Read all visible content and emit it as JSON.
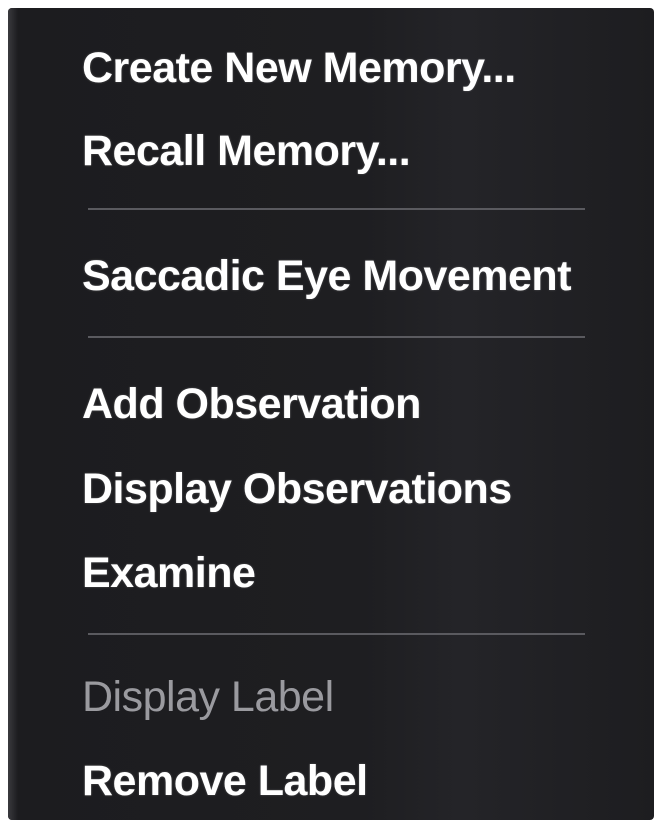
{
  "menu": {
    "items": [
      {
        "label": "Create New Memory...",
        "enabled": true
      },
      {
        "label": "Recall Memory...",
        "enabled": true
      },
      {
        "label": "Saccadic Eye Movement",
        "enabled": true
      },
      {
        "label": "Add Observation",
        "enabled": true
      },
      {
        "label": "Display Observations",
        "enabled": true
      },
      {
        "label": "Examine",
        "enabled": true
      },
      {
        "label": "Display Label",
        "enabled": false
      },
      {
        "label": "Remove Label",
        "enabled": true
      }
    ]
  },
  "colors": {
    "background": "#1e1e21",
    "text": "#ffffff",
    "disabled_text": "#9a9a9f",
    "separator": "#5a5a5f"
  }
}
